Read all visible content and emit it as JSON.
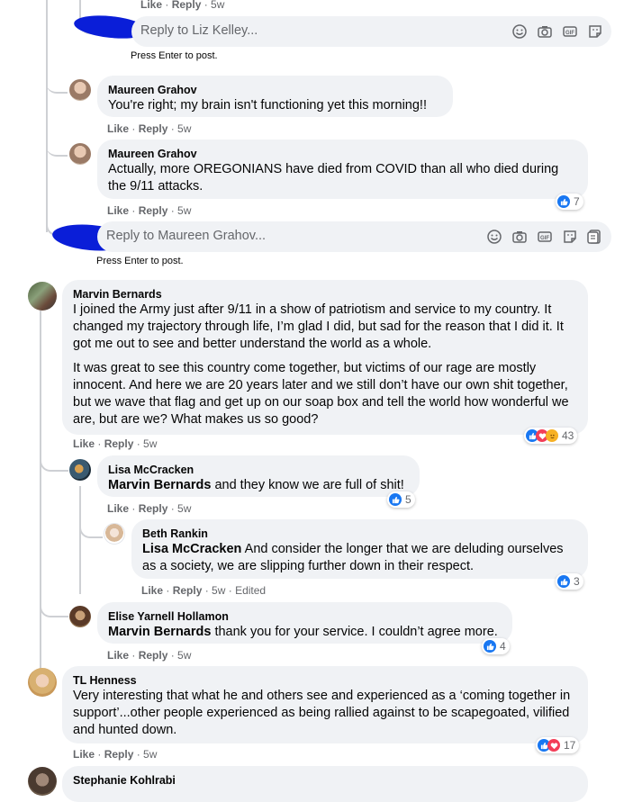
{
  "top_meta": {
    "like": "Like",
    "reply": "Reply",
    "time": "5w"
  },
  "reply_box_1": {
    "placeholder": "Reply to Liz Kelley...",
    "hint": "Press Enter to post."
  },
  "comments": [
    {
      "author": "Maureen Grahov",
      "text": "You're right; my brain isn't functioning yet this morning!!",
      "like": "Like",
      "reply": "Reply",
      "time": "5w"
    },
    {
      "author": "Maureen Grahov",
      "text": "Actually, more OREGONIANS have died from COVID than all who died during the 9/11 attacks.",
      "like": "Like",
      "reply": "Reply",
      "time": "5w",
      "reaction_count": "7"
    },
    {
      "author": "Marvin Bernards",
      "paragraph1": "I joined the Army just after 9/11 in a show of patriotism and service to my country. It changed my trajectory through life, I’m glad I did, but sad for the reason that I did it. It got me out to see and better understand the world as a whole.",
      "paragraph2": "It was great to see this country come together, but victims of our rage are mostly innocent. And here we are 20 years later and we still don’t have our own shit together, but we wave that flag and get up on our soap box and tell the world how wonderful we are, but are we? What makes us so good?",
      "like": "Like",
      "reply": "Reply",
      "time": "5w",
      "reaction_count": "43"
    },
    {
      "author": "Lisa McCracken",
      "mention": "Marvin Bernards",
      "text": " and they know we are full of shit!",
      "like": "Like",
      "reply": "Reply",
      "time": "5w",
      "reaction_count": "5"
    },
    {
      "author": "Beth Rankin",
      "mention": "Lisa McCracken",
      "text": " And consider the longer that we are deluding ourselves as a society, we are slipping further down in their respect.",
      "like": "Like",
      "reply": "Reply",
      "time": "5w",
      "edited": "Edited",
      "reaction_count": "3"
    },
    {
      "author": "Elise Yarnell Hollamon",
      "mention": "Marvin Bernards",
      "text": " thank you for your service. I couldn’t agree more.",
      "like": "Like",
      "reply": "Reply",
      "time": "5w",
      "reaction_count": "4"
    },
    {
      "author": "TL Henness",
      "text": "Very interesting that what he and others see and experienced as a ‘coming together in support’...other people experienced as being rallied against to be scapegoated, vilified and hunted down.",
      "like": "Like",
      "reply": "Reply",
      "time": "5w",
      "reaction_count": "17"
    },
    {
      "author": "Stephanie Kohlrabi"
    }
  ],
  "reply_box_2": {
    "placeholder": "Reply to Maureen Grahov...",
    "hint": "Press Enter to post."
  },
  "colors": {
    "bubble": "#f0f2f5",
    "like_blue": "#1877f2",
    "love_red": "#f33e58",
    "care_yellow": "#f7b125",
    "meta_gray": "#65676b",
    "redaction_blue": "#0a1ed8"
  },
  "icons": [
    "emoji-icon",
    "camera-icon",
    "gif-icon",
    "sticker-icon",
    "like-reaction-icon",
    "love-reaction-icon",
    "care-reaction-icon"
  ]
}
